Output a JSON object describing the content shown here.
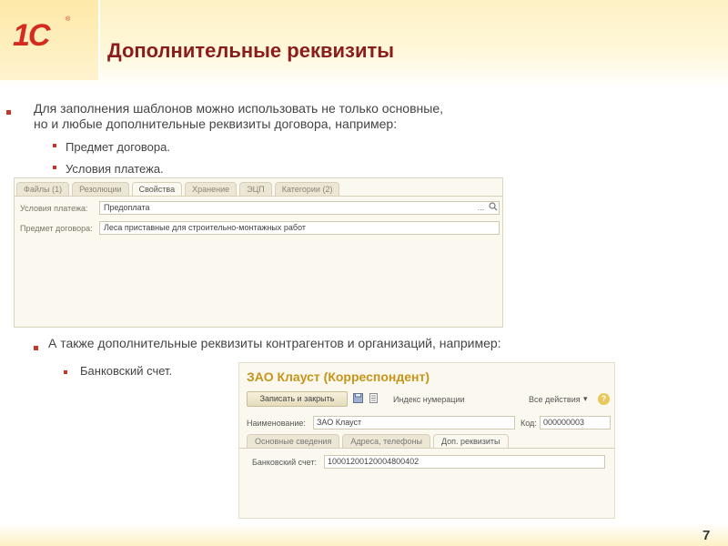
{
  "slide": {
    "logo": "1С",
    "logo_reg": "®",
    "title": "Дополнительные реквизиты",
    "page_number": "7"
  },
  "intro": {
    "line1": "Для заполнения шаблонов можно использовать не только основные,",
    "line2": "но и любые дополнительные реквизиты договора, например:",
    "items": [
      "Предмет договора.",
      "Условия платежа."
    ]
  },
  "contract_panel": {
    "tabs": [
      "Файлы (1)",
      "Резолюции",
      "Свойства",
      "Хранение",
      "ЭЦП",
      "Категории (2)"
    ],
    "active_tab": "Свойства",
    "payment_terms_label": "Условия платежа:",
    "payment_terms_value": "Предоплата",
    "subject_label": "Предмет договора:",
    "subject_value": "Леса приставные для строительно-монтажных работ",
    "select_button": "...",
    "search_icon": "search-icon"
  },
  "second": {
    "text": "А также дополнительные реквизиты контрагентов и организаций, например:",
    "item": "Банковский счет."
  },
  "counterparty_form": {
    "title": "ЗАО Клауст (Корреспондент)",
    "save_close": "Записать и закрыть",
    "numbering_index": "Индекс нумерации",
    "all_actions": "Все действия",
    "help": "?",
    "name_label": "Наименование:",
    "name_value": "ЗАО Клауст",
    "code_label": "Код:",
    "code_value": "000000003",
    "tabs": [
      "Основные сведения",
      "Адреса, телефоны",
      "Доп. реквизиты"
    ],
    "active_tab": "Доп. реквизиты",
    "bank_label": "Банковский счет:",
    "bank_value": "10001200120004800402"
  }
}
